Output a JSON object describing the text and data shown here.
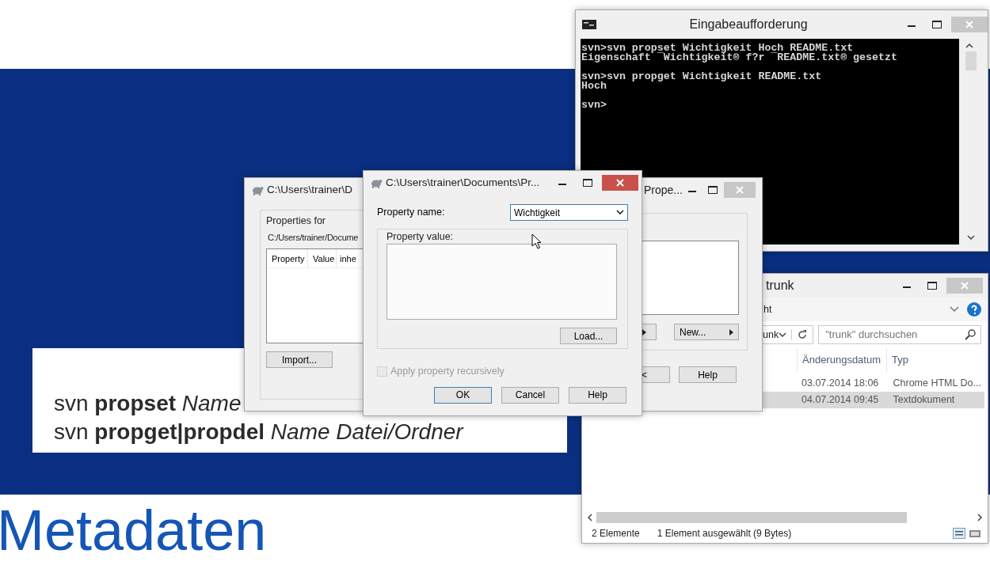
{
  "slide": {
    "lines": [
      "svn **propset** *Name*",
      "svn **propget|propdel** *Name Datei/Ordner*"
    ],
    "title": "Metadaten"
  },
  "console": {
    "title": "Eingabeaufforderung",
    "blocks": [
      [
        "svn>svn propset Wichtigkeit Hoch README.txt",
        "Eigenschaft ¯Wichtigkeit® f?r ¯README.txt® gesetzt"
      ],
      [
        "svn>svn propget Wichtigkeit README.txt",
        "Hoch"
      ],
      [
        "svn>"
      ]
    ]
  },
  "explorer": {
    "title": "trunk",
    "ribbon": "ht",
    "breadcrumb": "unk",
    "search": {
      "placeholder": "\"trunk\" durchsuchen"
    },
    "columns": [
      "Änderungsdatum",
      "Typ"
    ],
    "rows": [
      {
        "cells": [
          "03.07.2014 18:06",
          "Chrome HTML Do..."
        ],
        "selected": false
      },
      {
        "cells": [
          "04.07.2014 09:45",
          "Textdokument"
        ],
        "selected": true
      }
    ],
    "status": [
      "2 Elemente",
      "1 Element ausgewählt (9 Bytes)"
    ]
  },
  "properties_back": {
    "title": "Prope...",
    "buttons": [
      {
        "label": "New...",
        "menu": true
      },
      {
        "label": "<",
        "menu": false
      },
      {
        "label": "Help",
        "menu": false
      }
    ]
  },
  "properties_window": {
    "title": "C:\\Users\\trainer\\D",
    "group_label": "Properties for",
    "path": "C:/Users/trainer/Docume",
    "columns": [
      "Property",
      "Value",
      "inhe"
    ],
    "buttons": [
      "Import..."
    ]
  },
  "dialog": {
    "title": "C:\\Users\\trainer\\Documents\\Pr...",
    "name_label": "Property name:",
    "name_value": "Wichtigkeit",
    "value_label": "Property value:",
    "load_button": "Load...",
    "recursive": {
      "label": "Apply property recursively",
      "checked": false,
      "disabled": true
    },
    "buttons": [
      {
        "label": "OK",
        "default": true
      },
      {
        "label": "Cancel",
        "default": false
      },
      {
        "label": "Help",
        "default": false
      }
    ]
  }
}
